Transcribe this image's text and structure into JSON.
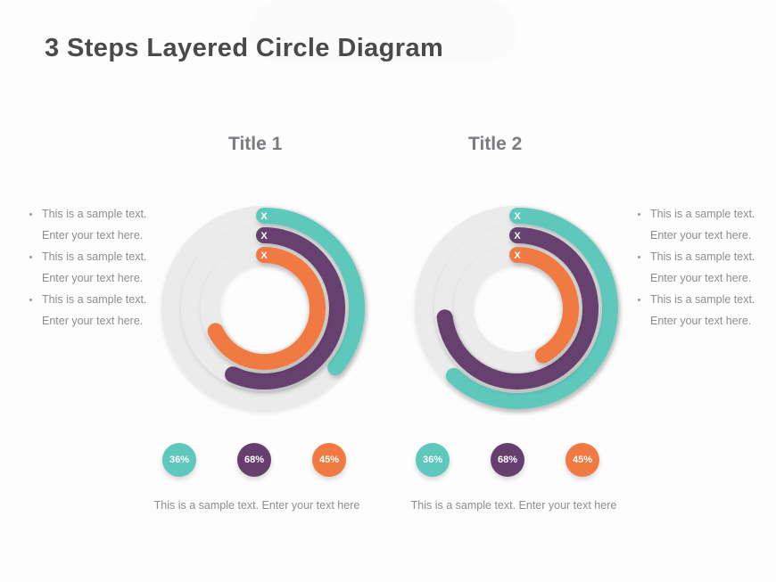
{
  "page": {
    "title": "3 Steps Layered Circle Diagram",
    "background_color": "#fdfdfd",
    "title_color": "#4a4a4a"
  },
  "palette": {
    "teal": "#5ec8bd",
    "purple": "#663f6e",
    "orange": "#f07a42",
    "track": "#ebebeb",
    "text_gray": "#8d8d92",
    "title_gray": "#7b7b80"
  },
  "columns": [
    {
      "id": "column-1",
      "title": "Title 1",
      "bullets": [
        "This is a sample text. Enter your text here.",
        "This is a sample text. Enter your text here.",
        "This is a sample text. Enter your text here."
      ],
      "bullets_side": "left",
      "badges": [
        {
          "label": "36%",
          "color": "#5ec8bd"
        },
        {
          "label": "68%",
          "color": "#663f6e"
        },
        {
          "label": "45%",
          "color": "#f07a42"
        }
      ],
      "caption": "This is a sample text. Enter your text here",
      "ring_labels": [
        "X",
        "X",
        "X"
      ]
    },
    {
      "id": "column-2",
      "title": "Title 2",
      "bullets": [
        "This is a sample text. Enter your text here.",
        "This is a sample text. Enter your text here.",
        "This is a sample text. Enter your text here."
      ],
      "bullets_side": "right",
      "badges": [
        {
          "label": "36%",
          "color": "#5ec8bd"
        },
        {
          "label": "68%",
          "color": "#663f6e"
        },
        {
          "label": "45%",
          "color": "#f07a42"
        }
      ],
      "caption": "This is a sample text. Enter your text here",
      "ring_labels": [
        "X",
        "X",
        "X"
      ]
    }
  ],
  "chart_data": [
    {
      "type": "pie",
      "subtype": "concentric-donut-gauge",
      "title": "Title 1",
      "legend": "none",
      "start_angle_deg": -90,
      "direction": "clockwise",
      "track_color": "#ebebeb",
      "series": [
        {
          "name": "Outer ring",
          "label": "X",
          "value": 36,
          "display": "36%",
          "color": "#5ec8bd",
          "radius": 104,
          "thickness": 18
        },
        {
          "name": "Middle ring",
          "label": "X",
          "value": 68,
          "display": "68%",
          "color": "#663f6e",
          "radius": 82,
          "thickness": 18
        },
        {
          "name": "Inner ring",
          "label": "X",
          "value": 45,
          "display": "45%",
          "color": "#f07a42",
          "radius": 60,
          "thickness": 18
        }
      ],
      "arc_sweep_pct": [
        36,
        57,
        68
      ],
      "caption": "This is a sample text. Enter your text here"
    },
    {
      "type": "pie",
      "subtype": "concentric-donut-gauge",
      "title": "Title 2",
      "legend": "none",
      "start_angle_deg": -90,
      "direction": "clockwise",
      "track_color": "#ebebeb",
      "series": [
        {
          "name": "Outer ring",
          "label": "X",
          "value": 36,
          "display": "36%",
          "color": "#5ec8bd",
          "radius": 104,
          "thickness": 18
        },
        {
          "name": "Middle ring",
          "label": "X",
          "value": 68,
          "display": "68%",
          "color": "#663f6e",
          "radius": 82,
          "thickness": 18
        },
        {
          "name": "Inner ring",
          "label": "X",
          "value": 45,
          "display": "45%",
          "color": "#f07a42",
          "radius": 60,
          "thickness": 18
        }
      ],
      "arc_sweep_pct": [
        62,
        73,
        42
      ],
      "caption": "This is a sample text. Enter your text here"
    }
  ]
}
